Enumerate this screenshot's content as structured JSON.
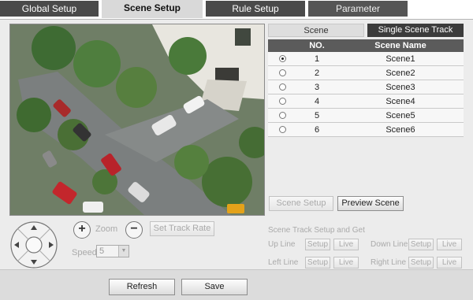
{
  "tabs": [
    "Global Setup",
    "Scene Setup",
    "Rule Setup",
    "Parameter"
  ],
  "ptz": {
    "zoom_label": "Zoom",
    "set_track_rate": "Set Track Rate",
    "speed_label": "Speed",
    "speed_value": "5"
  },
  "scene_panel": {
    "tabs": [
      "Scene",
      "Single Scene Track"
    ],
    "headers": {
      "no": "NO.",
      "name": "Scene Name"
    },
    "rows": [
      {
        "no": "1",
        "name": "Scene1",
        "selected": true
      },
      {
        "no": "2",
        "name": "Scene2",
        "selected": false
      },
      {
        "no": "3",
        "name": "Scene3",
        "selected": false
      },
      {
        "no": "4",
        "name": "Scene4",
        "selected": false
      },
      {
        "no": "5",
        "name": "Scene5",
        "selected": false
      },
      {
        "no": "6",
        "name": "Scene6",
        "selected": false
      }
    ],
    "scene_setup": "Scene Setup",
    "preview_scene": "Preview Scene"
  },
  "track_setup": {
    "title": "Scene Track Setup and Get",
    "up_line": "Up Line",
    "down_line": "Down Line",
    "left_line": "Left Line",
    "right_line": "Right Line",
    "setup": "Setup",
    "live": "Live"
  },
  "footer": {
    "refresh": "Refresh",
    "save": "Save"
  }
}
